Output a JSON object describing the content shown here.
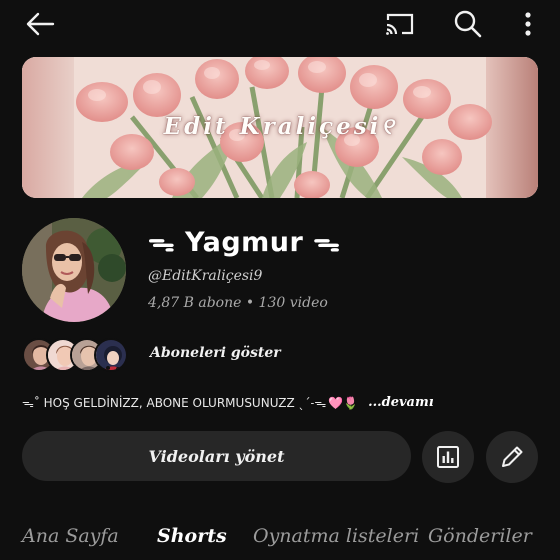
{
  "header": {
    "back_icon": "arrow-left-icon",
    "cast_icon": "cast-icon",
    "search_icon": "search-icon",
    "more_icon": "more-vert-icon"
  },
  "banner": {
    "title": "Edit Kraliçesi୧"
  },
  "channel": {
    "name": "ᯓ Yagmur ᯓ",
    "handle": "@EditKraliçesi9",
    "stats": "4,87 B abone • 130 video"
  },
  "subscribers": {
    "label": "Aboneleri göster"
  },
  "description": {
    "text": "ᯓ˚ HOŞ GELDİNİZZ, ABONE OLURMUSUNUZZ ˎˊ˗ᯓ",
    "emoji": "🩷🌷",
    "more": "...devamı"
  },
  "actions": {
    "manage_videos": "Videoları yönet",
    "analytics_icon": "analytics-icon",
    "edit_icon": "pencil-icon"
  },
  "tabs": [
    {
      "label": "Ana Sayfa",
      "active": false
    },
    {
      "label": "Shorts",
      "active": true
    },
    {
      "label": "Oynatma listeleri",
      "active": false
    },
    {
      "label": "Gönderiler",
      "active": false
    }
  ],
  "colors": {
    "background": "#0f0f0f",
    "button": "#272727",
    "text": "#f1f1f1",
    "muted": "#aaaaaa"
  }
}
